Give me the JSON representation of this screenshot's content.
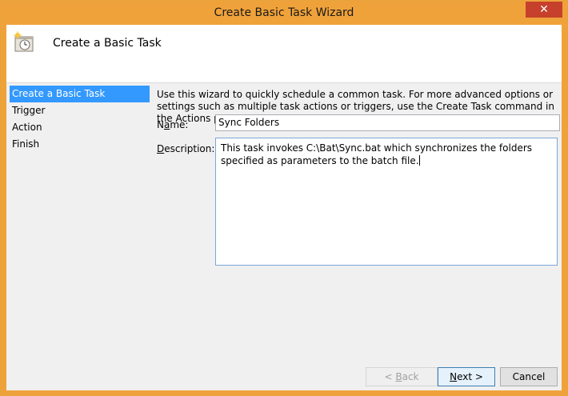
{
  "window": {
    "title": "Create Basic Task Wizard",
    "close_glyph": "✕"
  },
  "header": {
    "title": "Create a Basic Task",
    "icon": "task-scheduler-clock-icon"
  },
  "nav": {
    "items": [
      {
        "label": "Create a Basic Task",
        "active": true
      },
      {
        "label": "Trigger"
      },
      {
        "label": "Action"
      },
      {
        "label": "Finish"
      }
    ]
  },
  "intro": "Use this wizard to quickly schedule a common task.  For more advanced options or settings such as multiple task actions or triggers, use the Create Task command in the Actions pane.",
  "form": {
    "name_label_pre": "N",
    "name_label_acc": "a",
    "name_label_post": "me:",
    "name_value": "Sync Folders",
    "desc_label_acc": "D",
    "desc_label_post": "escription:",
    "desc_value": "This task invokes C:\\Bat\\Sync.bat which synchronizes the folders specified as parameters to the batch file."
  },
  "buttons": {
    "back_pre": "< ",
    "back_acc": "B",
    "back_post": "ack",
    "next_acc": "N",
    "next_post": "ext >",
    "cancel": "Cancel"
  }
}
